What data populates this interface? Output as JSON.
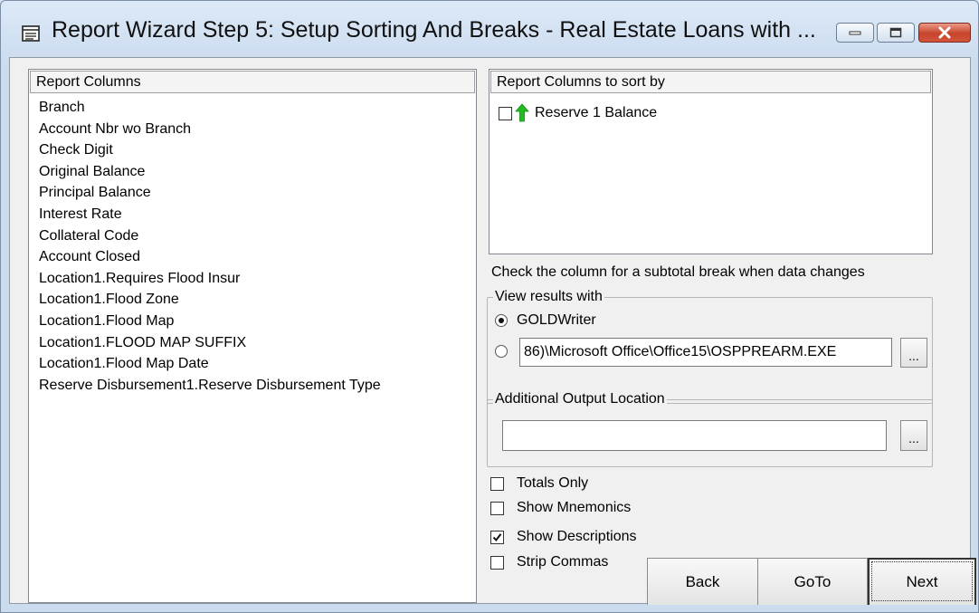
{
  "window": {
    "title": "Report Wizard Step 5:  Setup Sorting And Breaks - Real Estate Loans with ..."
  },
  "report_columns": {
    "header": "Report Columns",
    "items": [
      "Branch",
      "Account Nbr wo Branch",
      "Check Digit",
      "Original Balance",
      "Principal Balance",
      "Interest Rate",
      "Collateral Code",
      "Account Closed",
      "Location1.Requires Flood Insur",
      "Location1.Flood Zone",
      "Location1.Flood Map",
      "Location1.FLOOD MAP SUFFIX",
      "Location1.Flood Map Date",
      "Reserve Disbursement1.Reserve Disbursement Type"
    ]
  },
  "sort_columns": {
    "header": "Report Columns to sort by",
    "items": [
      {
        "label": "Reserve 1 Balance",
        "checked": false,
        "direction": "ascending"
      }
    ]
  },
  "break_hint": "Check the column for a subtotal break when data changes",
  "view_results": {
    "label": "View results with",
    "option_goldwriter": "GOLDWriter",
    "selected": "GOLDWriter",
    "custom_path": "86)\\Microsoft Office\\Office15\\OSPPREARM.EXE",
    "browse_label": "..."
  },
  "additional_output": {
    "label": "Additional Output Location",
    "value": "",
    "browse_label": "..."
  },
  "options": {
    "totals_only": {
      "label": "Totals Only",
      "checked": false
    },
    "show_mnemonics": {
      "label": "Show Mnemonics",
      "checked": false
    },
    "show_descriptions": {
      "label": "Show Descriptions",
      "checked": true
    },
    "strip_commas": {
      "label": "Strip Commas",
      "checked": false
    }
  },
  "buttons": {
    "back": "Back",
    "goto": "GoTo",
    "next": "Next"
  },
  "colors": {
    "sort_arrow": "#22bb22"
  }
}
